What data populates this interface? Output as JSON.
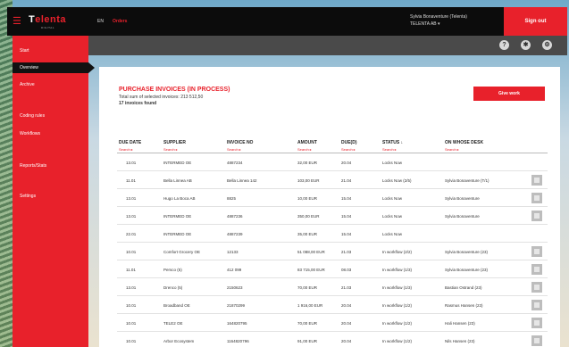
{
  "app": {
    "logo": "T",
    "logo_accent": "elenta",
    "sublogo": "DIGITAL",
    "nav_lang": "EN",
    "nav_active": "Orders",
    "user_name": "Sylvia Bonaventure (Telenta)",
    "user_company": "TELENTA AB ▾",
    "logout_label": "Sign out"
  },
  "sidebar": {
    "items": [
      {
        "label": "Start",
        "active": false
      },
      {
        "label": "Overview",
        "active": true
      },
      {
        "label": "Archive",
        "active": false
      },
      {
        "label": "Coding rules",
        "active": false
      },
      {
        "label": "Workflows",
        "active": false
      },
      {
        "label": "Reports/Stats",
        "active": false
      },
      {
        "label": "Settings",
        "active": false
      }
    ]
  },
  "toolbar_icons": [
    "help-icon",
    "settings-icon",
    "gear-icon"
  ],
  "page": {
    "heading": "PURCHASE INVOICES (IN PROCESS)",
    "total_line": "Total sum of selected invoices: 213 512,50",
    "count_line": "17 invoices found",
    "action_label": "Give work"
  },
  "table": {
    "columns": [
      "DUE DATE",
      "SUPPLIER",
      "INVOICE NO",
      "AMOUNT",
      "DUE(D)",
      "STATUS ↓",
      "ON WHOSE DESK"
    ],
    "search_label": "Search ▸",
    "rows": [
      {
        "date": "13.01",
        "supplier": "INTERMED OE",
        "inv": "4887234",
        "amount": "32,00 EUR",
        "due": "20.04",
        "status": "Locks Now",
        "desk": "",
        "chk": false
      },
      {
        "date": "11.01",
        "supplier": "Bella Linnea AB",
        "inv": "Bella Linnea 142",
        "amount": "103,00 EUR",
        "due": "21.04",
        "status": "Locks Now (2/5)",
        "desk": "Sylvia Bonaventure (T/1)",
        "chk": true
      },
      {
        "date": "13.01",
        "supplier": "Hugo La Boca AB",
        "inv": "8825",
        "amount": "10,00 EUR",
        "due": "15.04",
        "status": "Locks Now",
        "desk": "Sylvia Bonaventure",
        "chk": true
      },
      {
        "date": "13.01",
        "supplier": "INTERMED OE",
        "inv": "4887236",
        "amount": "350,00 EUR",
        "due": "15.04",
        "status": "Locks Now",
        "desk": "Sylvia Bonaventure",
        "chk": true
      },
      {
        "date": "22.01",
        "supplier": "INTERMED OE",
        "inv": "4887239",
        "amount": "35,00 EUR",
        "due": "15.04",
        "status": "Locks Now",
        "desk": "",
        "chk": false
      },
      {
        "date": "10.01",
        "supplier": "Comfort Grocery OE",
        "inv": "12133",
        "amount": "51 088,00 EUR",
        "due": "21.03",
        "status": "In workflow (2/2)",
        "desk": "Sylvia Bonaventure (23)",
        "chk": true
      },
      {
        "date": "11.01",
        "supplier": "Persco (5)",
        "inv": "412 099",
        "amount": "83 715,00 EUR",
        "due": "08.03",
        "status": "In workflow (1/3)",
        "desk": "Sylvia Bonaventure (23)",
        "chk": true
      },
      {
        "date": "13.01",
        "supplier": "Drenco (5)",
        "inv": "2150623",
        "amount": "70,00 EUR",
        "due": "21.03",
        "status": "In workflow (1/3)",
        "desk": "Bastian Ostrand (23)",
        "chk": true
      },
      {
        "date": "10.01",
        "supplier": "Broadband OE",
        "inv": "21870299",
        "amount": "1 916,00 EUR",
        "due": "20.04",
        "status": "In workflow (1/2)",
        "desk": "Rasmus Hansen (23)",
        "chk": true
      },
      {
        "date": "10.01",
        "supplier": "TELE2 OE",
        "inv": "164820795",
        "amount": "70,00 EUR",
        "due": "20.04",
        "status": "In workflow (1/2)",
        "desk": "Hali Hansen (23)",
        "chk": true
      },
      {
        "date": "10.01",
        "supplier": "Arbor Ecosystem",
        "inv": "1164820796",
        "amount": "91,00 EUR",
        "due": "20.04",
        "status": "In workflow (1/2)",
        "desk": "Nils Hansen (23)",
        "chk": true
      }
    ]
  }
}
